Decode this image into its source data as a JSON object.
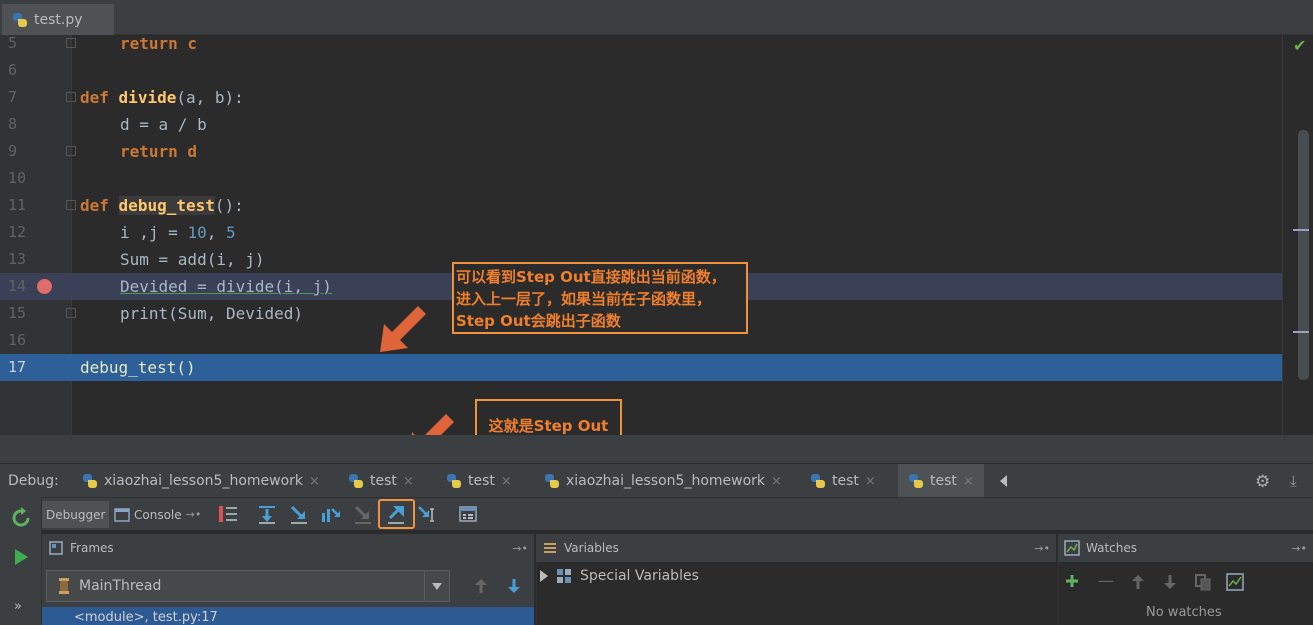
{
  "editor": {
    "file_tab": "test.py",
    "lines": [
      {
        "num": "5"
      },
      {
        "num": "6"
      },
      {
        "num": "7"
      },
      {
        "num": "8"
      },
      {
        "num": "9"
      },
      {
        "num": "10"
      },
      {
        "num": "11"
      },
      {
        "num": "12"
      },
      {
        "num": "13"
      },
      {
        "num": "14"
      },
      {
        "num": "15"
      },
      {
        "num": "16"
      },
      {
        "num": "17"
      }
    ],
    "code": {
      "l5": "return c",
      "l7_def": "def",
      "l7_name": "divide",
      "l7_rest": "(a, b):",
      "l8": "d = a / b",
      "l9": "return d",
      "l11_def": "def",
      "l11_name": "debug_test",
      "l11_rest": "():",
      "l12_a": "i ,j = ",
      "l12_b": "10",
      "l12_c": ", ",
      "l12_d": "5",
      "l13": "Sum = add(i, j)",
      "l14": "Devided = divide(i, j)",
      "l15": "print(Sum, Devided)",
      "l17": "debug_test()"
    }
  },
  "annotations": {
    "callout1": [
      "可以看到Step Out直接跳出当前函数，",
      "进入上一层了，如果当前在子函数里，",
      "Step Out会跳出子函数"
    ],
    "callout2": "这就是Step Out"
  },
  "debug": {
    "label": "Debug:",
    "tabs": [
      {
        "label": "xiaozhai_lesson5_homework"
      },
      {
        "label": "test"
      },
      {
        "label": "test"
      },
      {
        "label": "xiaozhai_lesson5_homework"
      },
      {
        "label": "test"
      },
      {
        "label": "test"
      }
    ],
    "close_glyph": "×",
    "subtabs": {
      "debugger": "Debugger",
      "console": "Console"
    },
    "frames_title": "Frames",
    "variables_title": "Variables",
    "watches_title": "Watches",
    "thread": "MainThread",
    "frame_row": "<module>, test.py:17",
    "special_vars": "Special Variables",
    "no_watches": "No watches"
  },
  "icons": {
    "settings": "gear-icon",
    "step_out": "step-out-icon"
  },
  "colors": {
    "accent": "#f0923e",
    "breakpoint": "#e06c6c",
    "current_line": "#2d6099"
  }
}
